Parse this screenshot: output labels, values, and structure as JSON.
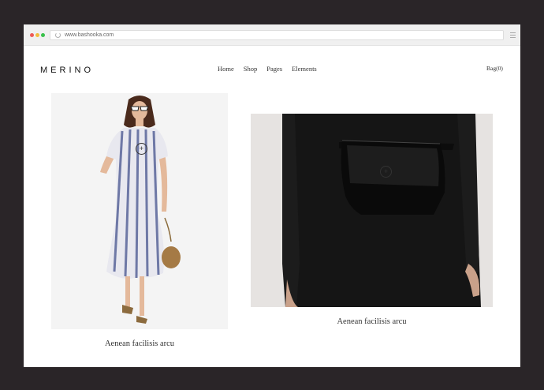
{
  "browser": {
    "url": "www.bashooka.com",
    "traffic_colors": {
      "red": "#ee5b56",
      "yellow": "#f2bd3c",
      "green": "#39c14b"
    }
  },
  "header": {
    "logo": "MERINO",
    "nav": [
      "Home",
      "Shop",
      "Pages",
      "Elements"
    ],
    "bag": "Bag(0)"
  },
  "products": [
    {
      "caption": "Aenean facilisis arcu",
      "hotspot_icon": "plus-circle-icon"
    },
    {
      "caption": "Aenean facilisis arcu",
      "hotspot_icon": "plus-circle-icon"
    }
  ]
}
